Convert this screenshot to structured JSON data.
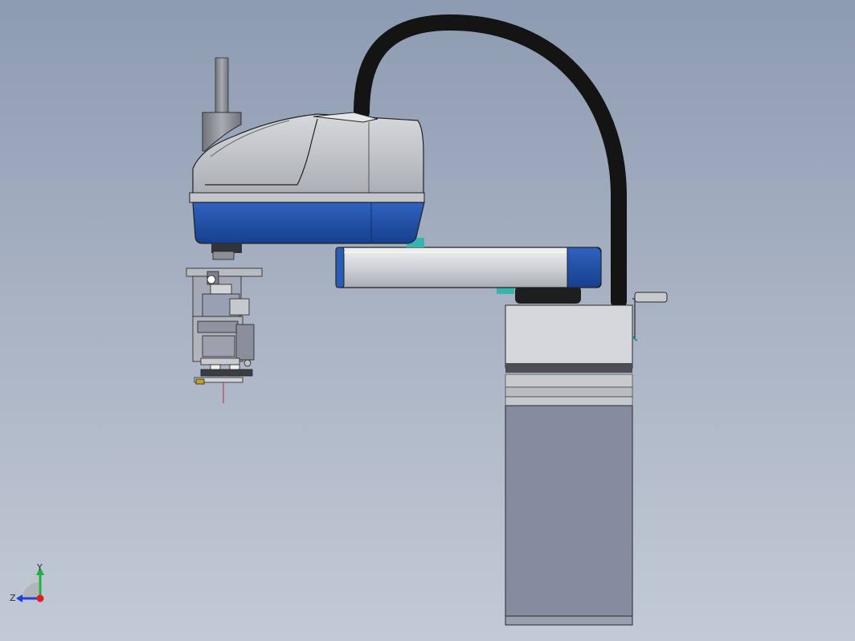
{
  "viewport": {
    "background_top": "#8d9bb2",
    "background_bottom": "#c3cad6"
  },
  "triad": {
    "x_label": "",
    "y_label": "Y",
    "z_label": "Z",
    "colors": {
      "x": "#e02020",
      "y": "#22b040",
      "z": "#2040e0"
    }
  },
  "robot": {
    "accent_blue": "#1f4fa8",
    "shell_gray": "#bfc2c6",
    "cable_black": "#141414",
    "base_column": "#868ba0"
  },
  "icons": [
    "coordinate-triad-icon"
  ]
}
